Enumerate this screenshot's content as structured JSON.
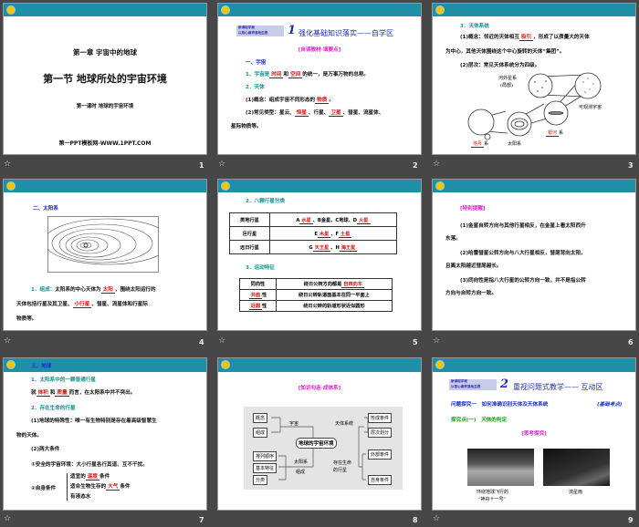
{
  "slide_numbers": [
    "1",
    "2",
    "3",
    "4",
    "5",
    "6",
    "7",
    "8",
    "9"
  ],
  "star_icon": "☆",
  "colors": {
    "header": "#1e8fa6",
    "blank": "#e01010",
    "teal": "#12918f",
    "blue": "#1a2ccc",
    "magenta": "#e020d0"
  },
  "s1": {
    "chapter": "第一章  宇宙中的地球",
    "title": "第一节 地球所处的宇宙环境",
    "subtitle": "第一课时  地球的宇宙环境",
    "site": "第一PPT模板网-WWW.1PPT.COM"
  },
  "banner": {
    "l1": "新课程学案",
    "l2": "以核心素养落地生根"
  },
  "s2": {
    "num": "1",
    "heading": "强化基础知识落实——自学区",
    "tag": "[自读教材·填要点]",
    "h1": "一、宇宙",
    "l1a": "1．宇宙是",
    "b1": "时间",
    "l1b": "和",
    "b2": "空间",
    "l1c": "的统一，是万事万物的总称。",
    "h2": "2．天体",
    "l2a": "(1)概念：组成宇宙不同形态的",
    "b3": "物质",
    "l2b": "。",
    "l3a": "(2)常见类型：星云、",
    "b4": "恒星",
    "l3b": "、行星、",
    "b5": "卫星",
    "l3c": "、彗星、流星体、",
    "l3d": "星际物质等。"
  },
  "s3": {
    "h": "3．天体系统",
    "l1a": "(1)概念：邻近的天体相互",
    "b1": "吸引",
    "l1b": "，形成了以质量大的天体",
    "l1c": "为中心，其他天体围绕这个中心旋转的天体“集团”。",
    "l2": "(2)层次：常见天体系统分为四级。",
    "d_galaxies": "河外星系",
    "d_partial": "(局部)",
    "d_universe": "可观测宇宙",
    "d_milky_b": "银河",
    "d_sys": "系",
    "d_em_b": "地月",
    "d_sun": "太阳系"
  },
  "s4": {
    "h": "二、太阳系",
    "l1a": "1．组成：",
    "l1b": "太阳系的中心天体为",
    "b1": "太阳",
    "l1c": "，围绕太阳运行的",
    "l2a": "天体包括行星及其卫星、",
    "b2": "小行星",
    "l2b": "、彗星、流星体和行星际",
    "l3": "物质等。"
  },
  "s5": {
    "h1": "2．八颗行星分类",
    "rows": [
      {
        "k": "类地行星",
        "a": "A",
        "b1": "水星",
        "m": "、B金星、C地球、D",
        "b2": "火星"
      },
      {
        "k": "巨行星",
        "a": "E",
        "b1": "木星",
        "m": "、F",
        "b2": "土星"
      },
      {
        "k": "远日行星",
        "a": "G",
        "b1": "天王星",
        "m": "、H",
        "b2": "海王星"
      }
    ],
    "h2": "3．运动特征",
    "m1k": "同向性",
    "m1a": "绕日公转方向都是",
    "m1b": "自西向东",
    "m2b": "共面",
    "m2s": "性",
    "m2v": "绕日公转轨道面基本在同一平面上",
    "m3b": "近圆",
    "m3s": "性",
    "m3v": "绕日公转的轨道形状近似圆形"
  },
  "s6": {
    "tag": "[特别提醒]",
    "p1a": "(1)金星自转方向与其他行星相反，在金星上看太阳西升",
    "p1b": "东落。",
    "p2a": "(2)哈雷彗星公转方向与八大行星相反，彗尾背向太阳，",
    "p2b": "且离太阳越近彗尾越长。",
    "p3a": "(3)同向性是指八大行星的公转方向一致，并不是指公转",
    "p3b": "方向与自转方向一致。"
  },
  "s7": {
    "h": "三、地球",
    "h1": "1．太阳系中的一颗普通行星",
    "l1a": "就",
    "b1": "体积",
    "l1b": "和",
    "b2": "质量",
    "l1c": "而言，在太阳系中并不突出。",
    "h2": "2．存在生命的行星",
    "l2a": "(1)地球的特殊性：唯一有生物特别是存在着高级智慧生",
    "l2b": "物的天体。",
    "l3": "(2)两大条件",
    "l4": "①安全的宇宙环境：大小行星各行其道、互不干扰。",
    "l5": "②自身条件",
    "c1a": "适宜的",
    "c1b": "温度",
    "c1c": "条件",
    "c2a": "适合生物生存的",
    "c2b": "大气",
    "c2c": "条件",
    "c3": "有液态水"
  },
  "s8": {
    "tag": "[知识勾连·成体系]",
    "center": "地球的宇宙环境",
    "universe": "宇宙",
    "concept": "概念",
    "composition": "组成",
    "solar": "太阳系",
    "solar2": "组成",
    "order": "排列顺序",
    "features": "基本特征",
    "classify": "分类",
    "celestial": "天体系统",
    "form": "形成条件",
    "levels": "层次划分",
    "life1": "存在生命",
    "life2": "的行星",
    "outer": "外部条件",
    "self": "自身条件"
  },
  "s9": {
    "num": "2",
    "heading": "重视问题式教学—— 互动区",
    "q": "问题探究一　如何准确识别天体及天体系统",
    "qtag": "(基础考点)",
    "p": "探究点(一)　天体的判定",
    "tag": "[思考探究]",
    "cap1a": "环绕地球飞行的",
    "cap1b": "“神舟十一号”",
    "cap2": "流星雨"
  }
}
